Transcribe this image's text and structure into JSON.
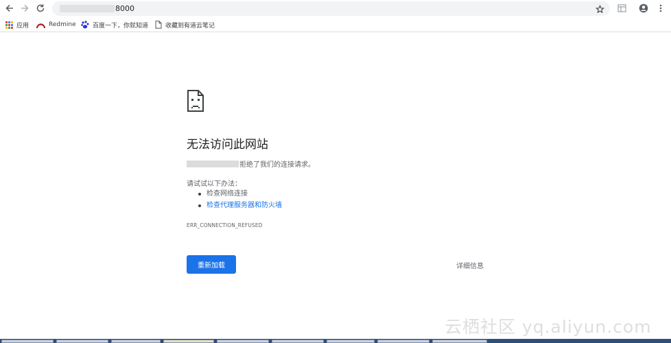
{
  "toolbar": {
    "url_text": "8000"
  },
  "bookmarks": [
    {
      "label": "应用",
      "icon": "apps-grid-icon"
    },
    {
      "label": "Redmine",
      "icon": "redmine-icon"
    },
    {
      "label": "百度一下，你就知道",
      "icon": "baidu-paw-icon"
    },
    {
      "label": "收藏到有道云笔记",
      "icon": "page-icon"
    }
  ],
  "error_page": {
    "heading": "无法访问此网站",
    "refused_text": "拒绝了我们的连接请求。",
    "try_title": "请试试以下办法：",
    "suggestions": [
      {
        "label": "检查网络连接",
        "link": false
      },
      {
        "label": "检查代理服务器和防火墙",
        "link": true
      }
    ],
    "error_code": "ERR_CONNECTION_REFUSED",
    "reload_label": "重新加载",
    "details_label": "详细信息"
  },
  "watermark": "云栖社区 yq.aliyun.com",
  "colors": {
    "accent": "#1a73e8",
    "text": "#202124",
    "secondary_text": "#5f6368"
  }
}
